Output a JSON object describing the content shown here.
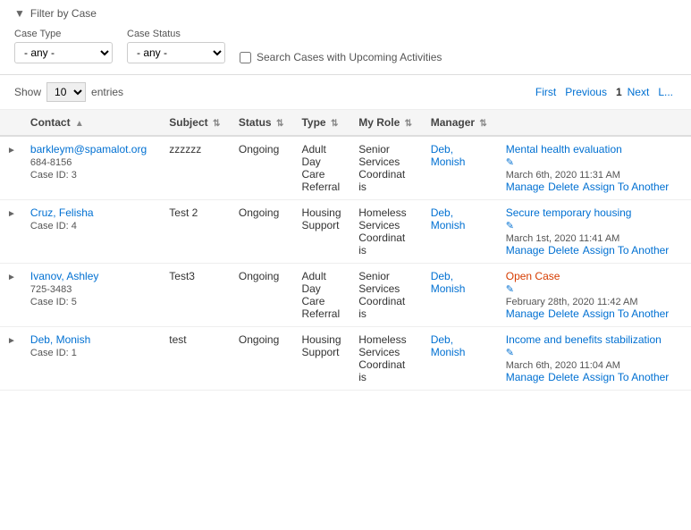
{
  "filter": {
    "header": "Filter by Case",
    "case_type_label": "Case Type",
    "case_type_default": "- any -",
    "case_status_label": "Case Status",
    "case_status_default": "- any -",
    "upcoming_checkbox_label": "Search Cases with Upcoming Activities"
  },
  "table_controls": {
    "show_label": "Show",
    "entries_label": "entries",
    "show_value": "10",
    "pagination_first": "First",
    "pagination_prev": "Previous",
    "pagination_current": "1",
    "pagination_next": "Next",
    "pagination_last": "L..."
  },
  "columns": {
    "contact": "Contact",
    "subject": "Subject",
    "status": "Status",
    "type": "Type",
    "my_role": "My Role",
    "manager": "Manager"
  },
  "rows": [
    {
      "id": "row1",
      "contact_name": "barkleym@spamalot.org",
      "contact_phone": "684-8156",
      "contact_case": "Case ID: 3",
      "subject": "zzzzzz",
      "status": "Ongoing",
      "type_line1": "Adult",
      "type_line2": "Day",
      "type_line3": "Care",
      "type_line4": "Referral",
      "role_line1": "Senior",
      "role_line2": "Services",
      "role_line3": "Coordinat",
      "role_line4": "is",
      "manager_first": "Deb,",
      "manager_last": "Monish",
      "case_title": "Mental health evaluation",
      "case_is_open": false,
      "case_date": "March 6th, 2020 11:31 AM",
      "actions": [
        "Manage",
        "Delete",
        "Assign To Another"
      ]
    },
    {
      "id": "row2",
      "contact_name": "Cruz, Felisha",
      "contact_phone": "",
      "contact_case": "Case ID: 4",
      "subject": "Test 2",
      "status": "Ongoing",
      "type_line1": "Housing",
      "type_line2": "Support",
      "type_line3": "",
      "type_line4": "",
      "role_line1": "Homeless",
      "role_line2": "Services",
      "role_line3": "Coordinat",
      "role_line4": "is",
      "manager_first": "Deb,",
      "manager_last": "Monish",
      "case_title": "Secure temporary housing",
      "case_is_open": false,
      "case_date": "March 1st, 2020 11:41 AM",
      "actions": [
        "Manage",
        "Delete",
        "Assign To Another"
      ]
    },
    {
      "id": "row3",
      "contact_name": "Ivanov, Ashley",
      "contact_phone": "725-3483",
      "contact_case": "Case ID: 5",
      "subject": "Test3",
      "status": "Ongoing",
      "type_line1": "Adult",
      "type_line2": "Day",
      "type_line3": "Care",
      "type_line4": "Referral",
      "role_line1": "Senior",
      "role_line2": "Services",
      "role_line3": "Coordinat",
      "role_line4": "is",
      "manager_first": "Deb,",
      "manager_last": "Monish",
      "case_title": "Open Case",
      "case_is_open": true,
      "case_date": "February 28th, 2020 11:42 AM",
      "actions": [
        "Manage",
        "Delete",
        "Assign To Another"
      ]
    },
    {
      "id": "row4",
      "contact_name": "Deb, Monish",
      "contact_phone": "",
      "contact_case": "Case ID: 1",
      "subject": "test",
      "status": "Ongoing",
      "type_line1": "Housing",
      "type_line2": "Support",
      "type_line3": "",
      "type_line4": "",
      "role_line1": "Homeless",
      "role_line2": "Services",
      "role_line3": "Coordinat",
      "role_line4": "is",
      "manager_first": "Deb,",
      "manager_last": "Monish",
      "case_title": "Income and benefits stabilization",
      "case_is_open": false,
      "case_date": "March 6th, 2020 11:04 AM",
      "actions": [
        "Manage",
        "Delete",
        "Assign To Another"
      ]
    }
  ]
}
